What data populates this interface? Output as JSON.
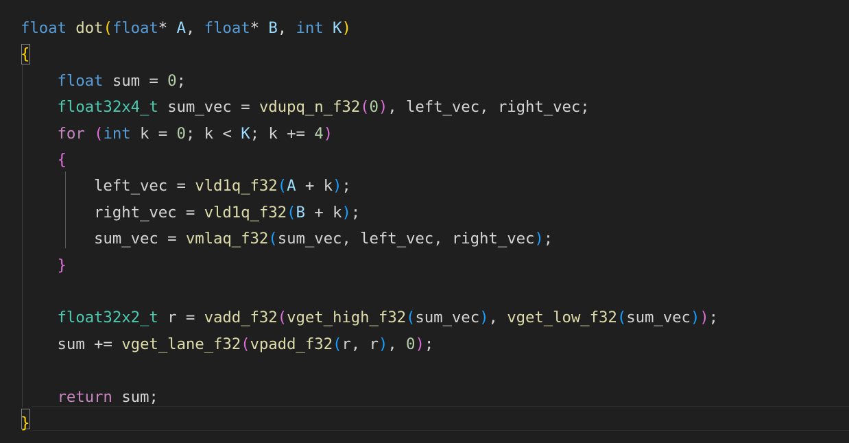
{
  "colors": {
    "background": "#1f1f1f",
    "keyword": "#569cd6",
    "control": "#c586c0",
    "type": "#4ec9b0",
    "function": "#dcdcaa",
    "parameter": "#9cdcfe",
    "number": "#b5cea8",
    "text": "#d4d4d4",
    "bracket1": "#ffd700",
    "bracket2": "#da70d6",
    "bracket3": "#179fff"
  },
  "code": {
    "lines": [
      [
        [
          "float",
          "keyword"
        ],
        [
          " ",
          "text"
        ],
        [
          "dot",
          "function"
        ],
        [
          "(",
          "bracket1"
        ],
        [
          "float",
          "keyword"
        ],
        [
          "* ",
          "text"
        ],
        [
          "A",
          "parameter"
        ],
        [
          ", ",
          "text"
        ],
        [
          "float",
          "keyword"
        ],
        [
          "* ",
          "text"
        ],
        [
          "B",
          "parameter"
        ],
        [
          ", ",
          "text"
        ],
        [
          "int",
          "keyword"
        ],
        [
          " ",
          "text"
        ],
        [
          "K",
          "parameter"
        ],
        [
          ")",
          "bracket1"
        ]
      ],
      [
        [
          "{",
          "bracket1"
        ]
      ],
      [
        [
          "    ",
          "text"
        ],
        [
          "float",
          "keyword"
        ],
        [
          " sum = ",
          "text"
        ],
        [
          "0",
          "number"
        ],
        [
          ";",
          "text"
        ]
      ],
      [
        [
          "    ",
          "text"
        ],
        [
          "float32x4_t",
          "type"
        ],
        [
          " sum_vec = ",
          "text"
        ],
        [
          "vdupq_n_f32",
          "function"
        ],
        [
          "(",
          "bracket2"
        ],
        [
          "0",
          "number"
        ],
        [
          ")",
          "bracket2"
        ],
        [
          ", left_vec, right_vec;",
          "text"
        ]
      ],
      [
        [
          "    ",
          "text"
        ],
        [
          "for",
          "control"
        ],
        [
          " ",
          "text"
        ],
        [
          "(",
          "bracket2"
        ],
        [
          "int",
          "keyword"
        ],
        [
          " k = ",
          "text"
        ],
        [
          "0",
          "number"
        ],
        [
          "; k < ",
          "text"
        ],
        [
          "K",
          "parameter"
        ],
        [
          "; k += ",
          "text"
        ],
        [
          "4",
          "number"
        ],
        [
          ")",
          "bracket2"
        ]
      ],
      [
        [
          "    ",
          "text"
        ],
        [
          "{",
          "bracket2"
        ]
      ],
      [
        [
          "        left_vec = ",
          "text"
        ],
        [
          "vld1q_f32",
          "function"
        ],
        [
          "(",
          "bracket3"
        ],
        [
          "A",
          "parameter"
        ],
        [
          " + k",
          "text"
        ],
        [
          ")",
          "bracket3"
        ],
        [
          ";",
          "text"
        ]
      ],
      [
        [
          "        right_vec = ",
          "text"
        ],
        [
          "vld1q_f32",
          "function"
        ],
        [
          "(",
          "bracket3"
        ],
        [
          "B",
          "parameter"
        ],
        [
          " + k",
          "text"
        ],
        [
          ")",
          "bracket3"
        ],
        [
          ";",
          "text"
        ]
      ],
      [
        [
          "        sum_vec = ",
          "text"
        ],
        [
          "vmlaq_f32",
          "function"
        ],
        [
          "(",
          "bracket3"
        ],
        [
          "sum_vec, left_vec, right_vec",
          "text"
        ],
        [
          ")",
          "bracket3"
        ],
        [
          ";",
          "text"
        ]
      ],
      [
        [
          "    ",
          "text"
        ],
        [
          "}",
          "bracket2"
        ]
      ],
      [],
      [
        [
          "    ",
          "text"
        ],
        [
          "float32x2_t",
          "type"
        ],
        [
          " r = ",
          "text"
        ],
        [
          "vadd_f32",
          "function"
        ],
        [
          "(",
          "bracket2"
        ],
        [
          "vget_high_f32",
          "function"
        ],
        [
          "(",
          "bracket3"
        ],
        [
          "sum_vec",
          "text"
        ],
        [
          ")",
          "bracket3"
        ],
        [
          ", ",
          "text"
        ],
        [
          "vget_low_f32",
          "function"
        ],
        [
          "(",
          "bracket3"
        ],
        [
          "sum_vec",
          "text"
        ],
        [
          ")",
          "bracket3"
        ],
        [
          ")",
          "bracket2"
        ],
        [
          ";",
          "text"
        ]
      ],
      [
        [
          "    sum += ",
          "text"
        ],
        [
          "vget_lane_f32",
          "function"
        ],
        [
          "(",
          "bracket2"
        ],
        [
          "vpadd_f32",
          "function"
        ],
        [
          "(",
          "bracket3"
        ],
        [
          "r, r",
          "text"
        ],
        [
          ")",
          "bracket3"
        ],
        [
          ", ",
          "text"
        ],
        [
          "0",
          "number"
        ],
        [
          ")",
          "bracket2"
        ],
        [
          ";",
          "text"
        ]
      ],
      [],
      [
        [
          "    ",
          "text"
        ],
        [
          "return",
          "control"
        ],
        [
          " sum;",
          "text"
        ]
      ],
      [
        [
          "}",
          "bracket1"
        ]
      ]
    ]
  }
}
